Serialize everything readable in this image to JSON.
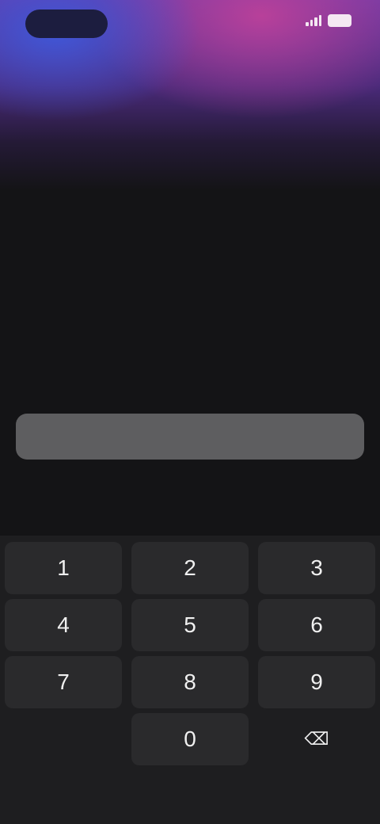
{
  "status_bar": {
    "time": ""
  },
  "header": {
    "title": "",
    "subtitle": ""
  },
  "form": {
    "label": "",
    "amount_placeholder": ""
  },
  "cta": {
    "label": ""
  },
  "keyboard": {
    "done_label": "",
    "keys": [
      "1",
      "2",
      "3",
      "4",
      "5",
      "6",
      "7",
      "8",
      "9",
      "",
      "0",
      "⌫"
    ]
  }
}
